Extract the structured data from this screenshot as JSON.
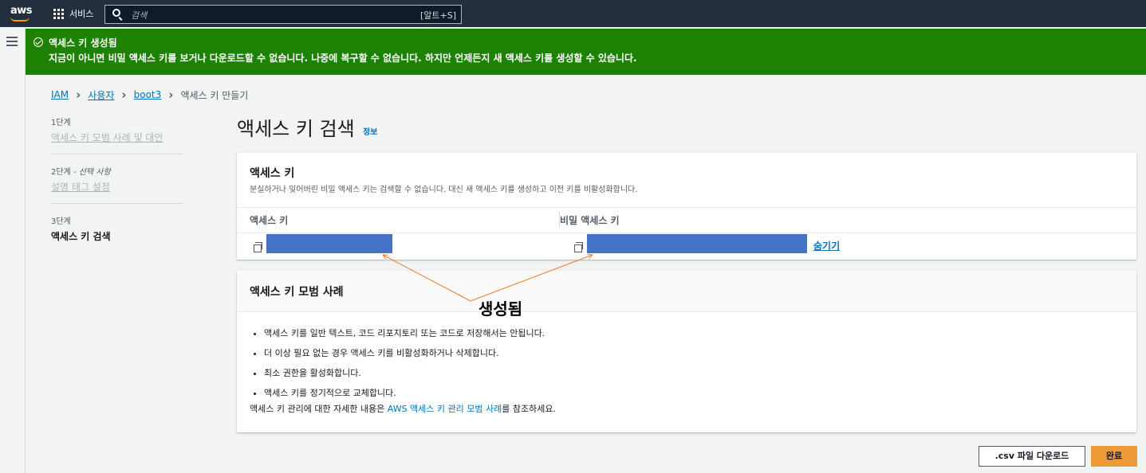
{
  "topnav": {
    "logo": "aws",
    "services_label": "서비스",
    "search_placeholder": "검색",
    "search_shortcut": "[알트+S]"
  },
  "flash": {
    "title": "액세스 키 생성됨",
    "message": "지금이 아니면 비밀 액세스 키를 보거나 다운로드할 수 없습니다. 나중에 복구할 수 없습니다. 하지만 언제든지 새 액세스 키를 생성할 수 있습니다."
  },
  "breadcrumb": {
    "items": [
      "IAM",
      "사용자",
      "boot3"
    ],
    "current": "액세스 키 만들기"
  },
  "steps": [
    {
      "num": "1단계",
      "label": "액세스 키 모범 사례 및 대안"
    },
    {
      "num": "2단계",
      "optional": " - 선택 사항",
      "label": "설명 태그 설정"
    },
    {
      "num": "3단계",
      "label": "액세스 키 검색"
    }
  ],
  "page": {
    "title": "액세스 키 검색",
    "info": "정보"
  },
  "keys_panel": {
    "heading": "액세스 키",
    "description": "분실하거나 잊어버린 비밀 액세스 키는 검색할 수 없습니다. 대신 새 액세스 키를 생성하고 이전 키를 비활성화합니다.",
    "col_access_key": "액세스 키",
    "col_secret_key": "비밀 액세스 키",
    "hide_label": "숨기기",
    "redact_color": "#4472c4"
  },
  "best_practices": {
    "heading": "액세스 키 모범 사례",
    "items": [
      "액세스 키를 일반 텍스트, 코드 리포지토리 또는 코드로 저장해서는 안됩니다.",
      "더 이상 필요 없는 경우 액세스 키를 비활성화하거나 삭제합니다.",
      "최소 권한을 활성화합니다.",
      "액세스 키를 정기적으로 교체합니다."
    ],
    "footer_prefix": "액세스 키 관리에 대한 자세한 내용은 ",
    "footer_link": "AWS 액세스 키 관리 모범 사례",
    "footer_suffix": "를 참조하세요."
  },
  "annotation": {
    "text": "생성됨",
    "arrow_color": "#ed7d31"
  },
  "buttons": {
    "csv": ".csv 파일 다운로드",
    "done": "완료"
  },
  "colors": {
    "nav": "#232f3e",
    "success": "#1d8102",
    "link": "#0073bb",
    "primary_button": "#ec9b38"
  }
}
